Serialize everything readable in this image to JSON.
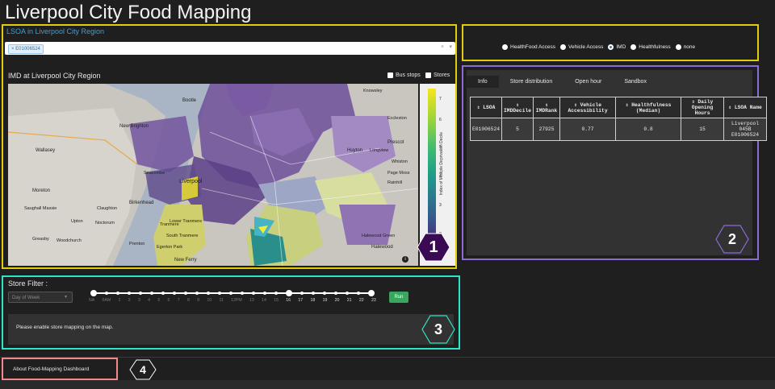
{
  "app_title": "Liverpool City Food Mapping",
  "lsoa": {
    "label": "LSOA in Liverpool City Region",
    "selected_tag": "× E01006524",
    "clear_icon": "×",
    "caret_icon": "▾"
  },
  "map_panel": {
    "title": "IMD at Liverpool City Region",
    "checkboxes": [
      "Bus stops",
      "Stores"
    ],
    "colorbar": {
      "title": "Index of Multiple Deprivation Decile",
      "ticks": [
        "7",
        "6",
        "5",
        "4",
        "3",
        "2"
      ]
    },
    "place_labels": [
      "Bootle",
      "New Brighton",
      "Wallasey",
      "Moreton",
      "Liverpool",
      "Birkenhead",
      "Huyton",
      "Prescot",
      "Whiston",
      "Tranmere",
      "Halewood",
      "New Ferry",
      "Woodchurch",
      "Greasby",
      "Upton",
      "Noctorum",
      "Seacombe",
      "Knowsley",
      "Eccleston",
      "Rainhill",
      "Halewood Green",
      "South Tranmere",
      "Egerton Park",
      "Lower Tranmere",
      "Claughton",
      "Prenton",
      "Saughall Massie",
      "Longview",
      "Page Moss"
    ],
    "info_icon": "i",
    "badge": "1"
  },
  "layer_selector": {
    "options": [
      "HealthFood Access",
      "Vehicle Access",
      "IMD",
      "Healthfulness",
      "none"
    ],
    "selected": "IMD"
  },
  "info_panel": {
    "tabs": [
      "Info",
      "Store distribution",
      "Open hour",
      "Sandbox"
    ],
    "active_tab": "Info",
    "sort_icon": "⇕",
    "columns": [
      "LSOA",
      "IMDDecile",
      "IMDRank",
      "Vehicle Accessibility",
      "Healthfulness (Median)",
      "Daily Opening Hours",
      "LSOA Name"
    ],
    "rows": [
      [
        "E01006524",
        "5",
        "27925",
        "0.77",
        "0.8",
        "15",
        "Liverpool 045B E01006524"
      ]
    ],
    "badge": "2"
  },
  "store_filter": {
    "label": "Store Filter :",
    "day_placeholder": "Day of Week",
    "caret_icon": "▾",
    "hours": [
      "NA",
      "0AM",
      "1",
      "2",
      "3",
      "4",
      "5",
      "6",
      "7",
      "8",
      "9",
      "10",
      "11",
      "12PM",
      "13",
      "14",
      "15",
      "16",
      "17",
      "18",
      "19",
      "20",
      "21",
      "22",
      "23"
    ],
    "run_label": "Run",
    "message": "Please enable store mapping on the map.",
    "badge": "3"
  },
  "about": {
    "label": "About Food-Mapping Dashboard",
    "badge": "4"
  },
  "colors": {
    "panel1_border": "#e2cc0f",
    "panel2_border": "#8c6bd6",
    "panel3_border": "#2ee3c6",
    "panel4_border": "#f08a8a",
    "run_button": "#3aa55f",
    "link_blue": "#3c9fd8"
  }
}
